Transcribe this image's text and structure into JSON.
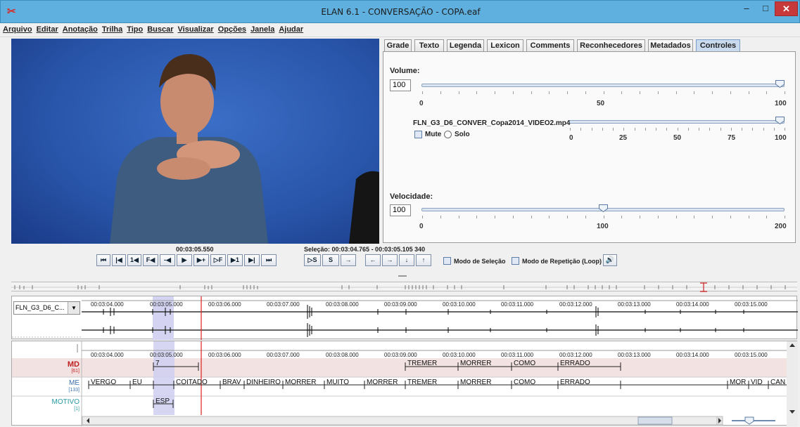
{
  "window": {
    "title": "ELAN 6.1 - CONVERSAÇÃO - COPA.eaf",
    "min": "–",
    "max": "□",
    "close": "✕",
    "icon": "elan-icon"
  },
  "menu": [
    "Arquivo",
    "Editar",
    "Anotação",
    "Trilha",
    "Tipo",
    "Buscar",
    "Visualizar",
    "Opções",
    "Janela",
    "Ajudar"
  ],
  "tabs": [
    "Grade",
    "Texto",
    "Legenda",
    "Lexicon",
    "Comments",
    "Reconhecedores",
    "Metadados",
    "Controles"
  ],
  "controls": {
    "volume_label": "Volume:",
    "volume_value": "100",
    "volume_level": 1.0,
    "volume_ticks": [
      "0",
      "50",
      "100"
    ],
    "media_file": "FLN_G3_D6_CONVER_Copa2014_VIDEO2.mp4",
    "media_level": 1.0,
    "media_ticks": [
      "0",
      "25",
      "50",
      "75",
      "100"
    ],
    "mute_label": "Mute",
    "solo_label": "Solo",
    "speed_label": "Velocidade:",
    "speed_value": "100",
    "speed_level": 0.5,
    "speed_ticks": [
      "0",
      "100",
      "200"
    ]
  },
  "player": {
    "current_time": "00:03:05.550",
    "selection": "Seleção: 00:03:04.765 - 00:03:05.105 340",
    "buttons": [
      "⏮",
      "|◀",
      "1◀",
      "F◀",
      "-◀",
      "▶",
      "▶+",
      "▷F",
      "▶1",
      "▶|",
      "⏭"
    ],
    "sel_buttons": [
      "▷S",
      "S",
      "→"
    ],
    "nav_buttons": [
      "←",
      "→",
      "↓",
      "↑"
    ],
    "selection_mode": "Modo de Seleção",
    "loop_mode": "Modo de Repetição (Loop)"
  },
  "wave": {
    "media": "FLN_G3_D6_C...",
    "ticks": [
      "00:03:04.000",
      "00:03:05.000",
      "00:03:06.000",
      "00:03:07.000",
      "00:03:08.000",
      "00:03:09.000",
      "00:03:10.000",
      "00:03:11.000",
      "00:03:12.000",
      "00:03:13.000",
      "00:03:14.000",
      "00:03:15.000"
    ]
  },
  "tiers": {
    "md_name": "MD",
    "md_count": "[61]",
    "me_name": "ME",
    "me_count": "[133]",
    "motivo_name": "MOTIVO",
    "motivo_count": "[1]",
    "md_annotations": [
      "7",
      "TREMER",
      "MORRER",
      "COMO",
      "ERRADO"
    ],
    "me_annotations": [
      "VERGO",
      "EU",
      "COITADO",
      "BRAV",
      "DINHEIRO",
      "MORRER",
      "MUITO",
      "MORRER",
      "TREMER",
      "MORRER",
      "COMO",
      "ERRADO",
      "MOR",
      "VID",
      "CANS"
    ],
    "motivo_annotations": [
      "ESP"
    ]
  },
  "colors": {
    "titlebar": "#5fb0de",
    "close": "#c7383a",
    "md_tier": "#f2e2e2",
    "selection": "#c8c8f0",
    "crosshair": "#e02020"
  }
}
